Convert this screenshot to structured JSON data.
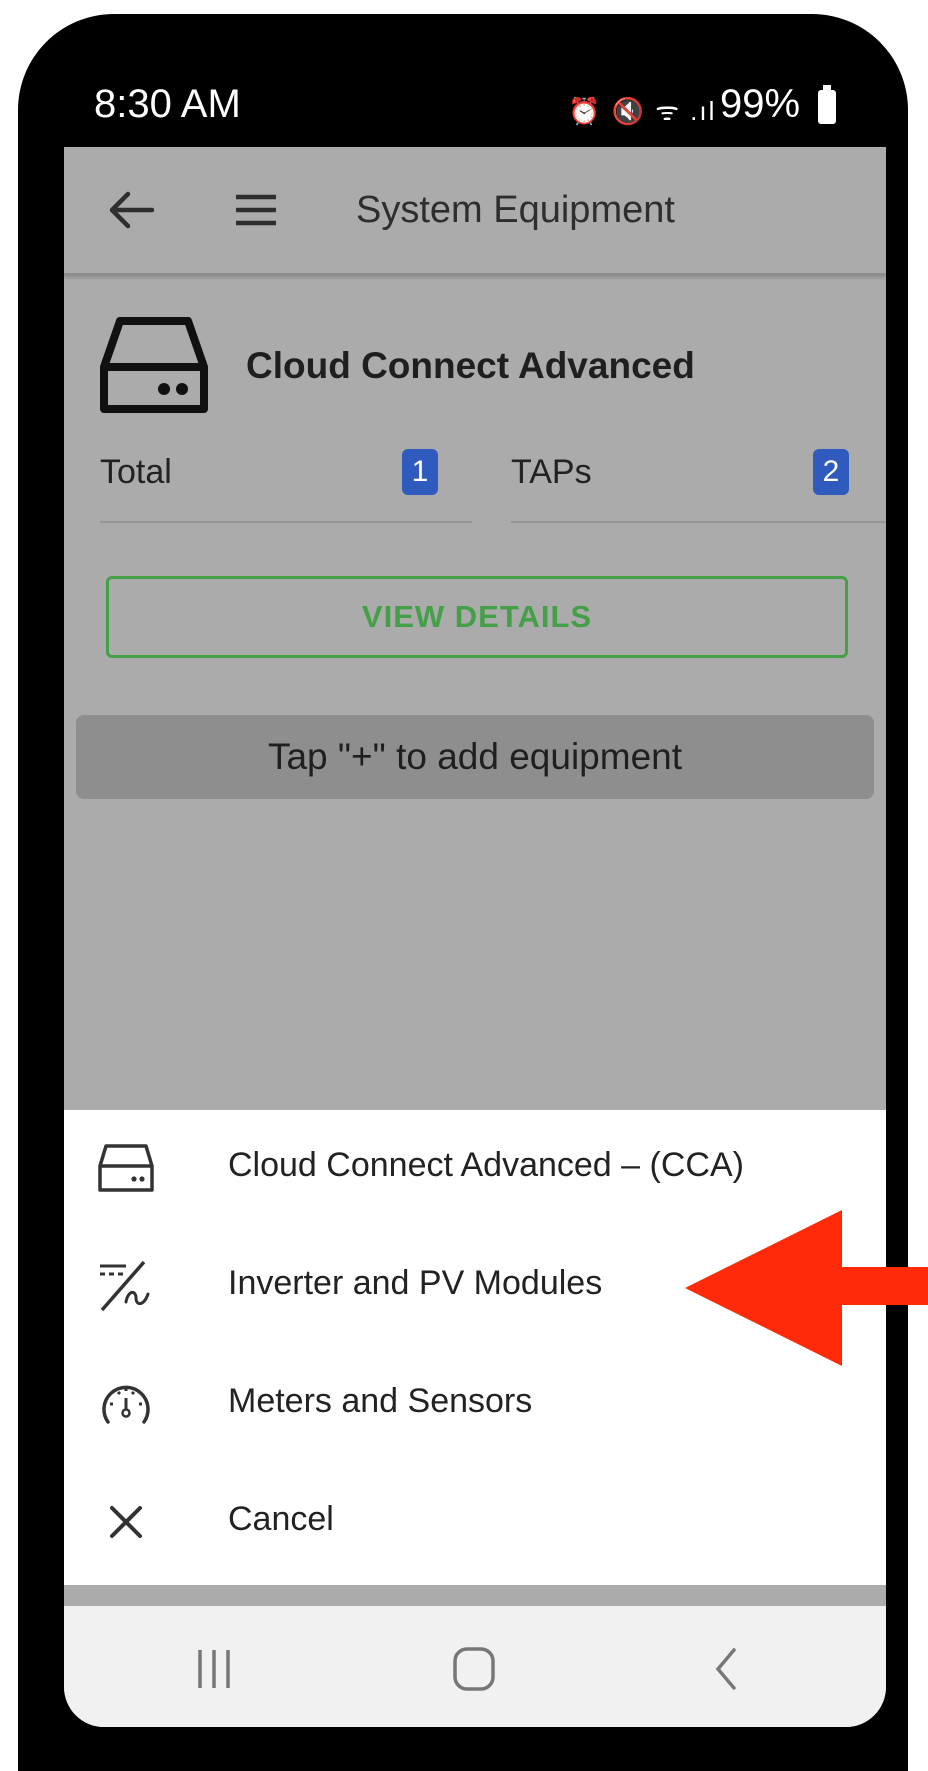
{
  "status_bar": {
    "time": "8:30 AM",
    "icons": "⏰ 🔇 ᯤ .ıl",
    "battery": "99%"
  },
  "app_bar": {
    "title": "System Equipment",
    "back_icon": "back-arrow-icon",
    "menu_icon": "hamburger-menu-icon"
  },
  "device": {
    "name": "Cloud Connect Advanced",
    "icon": "gateway-device-icon",
    "stats": [
      {
        "label": "Total",
        "count": "1"
      },
      {
        "label": "TAPs",
        "count": "2"
      }
    ],
    "view_details_label": "VIEW DETAILS"
  },
  "hint_text": "Tap \"+\" to add equipment",
  "bottom_sheet": {
    "items": [
      {
        "label": "Cloud Connect Advanced – (CCA)",
        "icon": "gateway-device-icon"
      },
      {
        "label": "Inverter and PV Modules",
        "icon": "inverter-icon"
      },
      {
        "label": "Meters and Sensors",
        "icon": "meter-gauge-icon"
      },
      {
        "label": "Cancel",
        "icon": "close-icon"
      }
    ]
  },
  "colors": {
    "accent_green": "#43a047",
    "badge_blue": "#2f5bbf",
    "pointer_red": "#ff2a0a"
  }
}
